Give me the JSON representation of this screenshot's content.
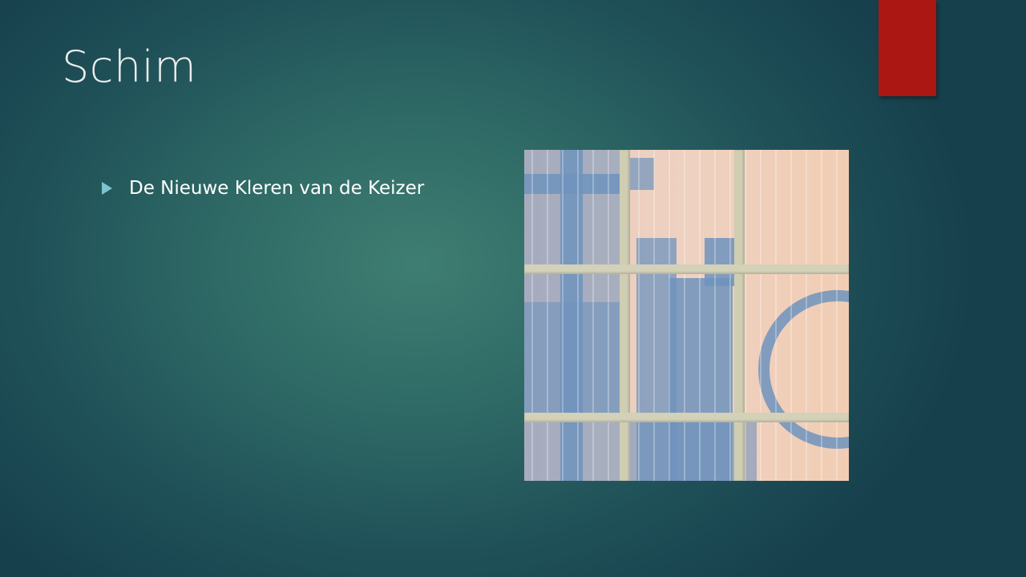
{
  "slide": {
    "title": "Schim",
    "bullets": [
      "De Nieuwe Kleren van de Keizer"
    ],
    "accent_color": "#ab1712",
    "bullet_color": "#7ec4cf"
  }
}
